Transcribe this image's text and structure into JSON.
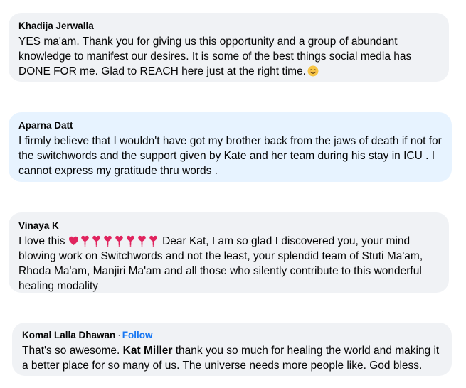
{
  "comments": [
    {
      "author": "Khadija Jerwalla",
      "text": "YES ma'am. Thank you for giving us this opportunity and a group of abundant knowledge to manifest our desires. It is some of the best things social media has DONE FOR me. Glad to REACH here just at the right time.",
      "emoji": "smiling-face-icon"
    },
    {
      "author": "Aparna Datt",
      "text": "I firmly believe that I wouldn't have got my brother back from the jaws of death if not for the switchwords and the support given by Kate and her team during his stay in ICU . I cannot express my gratitude thru words ."
    },
    {
      "author": "Vinaya K",
      "text_before": "I love this",
      "hearts": [
        "heart-icon",
        "heart-exclamation-icon",
        "heart-exclamation-icon",
        "heart-exclamation-icon",
        "heart-exclamation-icon",
        "heart-exclamation-icon",
        "heart-exclamation-icon",
        "heart-exclamation-icon"
      ],
      "text_after": "Dear Kat, I am so glad I discovered you, your mind blowing work on Switchwords and not the least, your splendid team of Stuti Ma'am, Rhoda Ma'am, Manjiri Ma'am and all those who silently contribute to this wonderful healing modality"
    },
    {
      "author": "Komal Lalla Dhawan",
      "separator": "·",
      "follow_label": "Follow",
      "text_before": "That's so awesome.",
      "mention": "Kat Miller",
      "text_after": "thank you so much for healing the world and making it a better place for so many of us. The universe needs more people like. God bless."
    }
  ],
  "colors": {
    "bubble": "#f0f2f5",
    "bubble_highlight": "#e7f3ff",
    "text": "#050505",
    "link": "#1877f2",
    "heart": "#e0245e"
  }
}
